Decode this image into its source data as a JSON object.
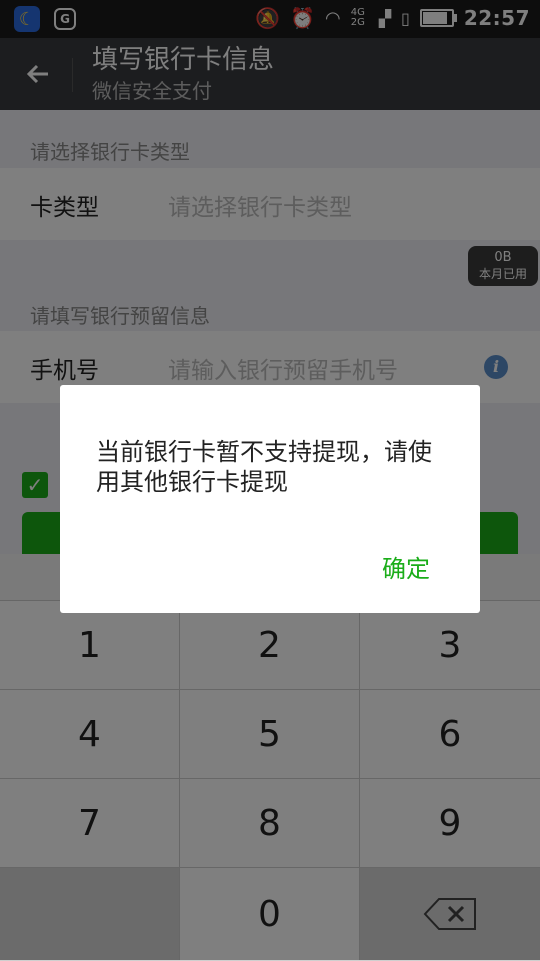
{
  "status_bar": {
    "time": "22:57",
    "network": "4G 2G",
    "battery_fraction": 0.92,
    "icons": [
      "moon-app-icon",
      "g-app-icon",
      "vibrate-off-icon",
      "alarm-icon",
      "wifi-icon",
      "signal-icon",
      "sim-icon",
      "battery-icon"
    ]
  },
  "header": {
    "title": "填写银行卡信息",
    "subtitle": "微信安全支付",
    "back_icon": "arrow-left-icon"
  },
  "card_section": {
    "label": "请选择银行卡类型",
    "row_label": "卡类型",
    "row_placeholder": "请选择银行卡类型"
  },
  "data_usage": {
    "value": "0B",
    "label": "本月已用"
  },
  "phone_section": {
    "label": "请填写银行预留信息",
    "row_label": "手机号",
    "row_placeholder": "请输入银行预留手机号",
    "info_icon": "info-icon"
  },
  "keypad": {
    "keys": [
      "1",
      "2",
      "3",
      "4",
      "5",
      "6",
      "7",
      "8",
      "9",
      "0"
    ]
  },
  "dialog": {
    "message": "当前银行卡暂不支持提现，请使用其他银行卡提现",
    "confirm": "确定"
  },
  "colors": {
    "accent": "#1aad19",
    "header_bg": "#393a3f",
    "status_bg": "#1b1b1b"
  }
}
